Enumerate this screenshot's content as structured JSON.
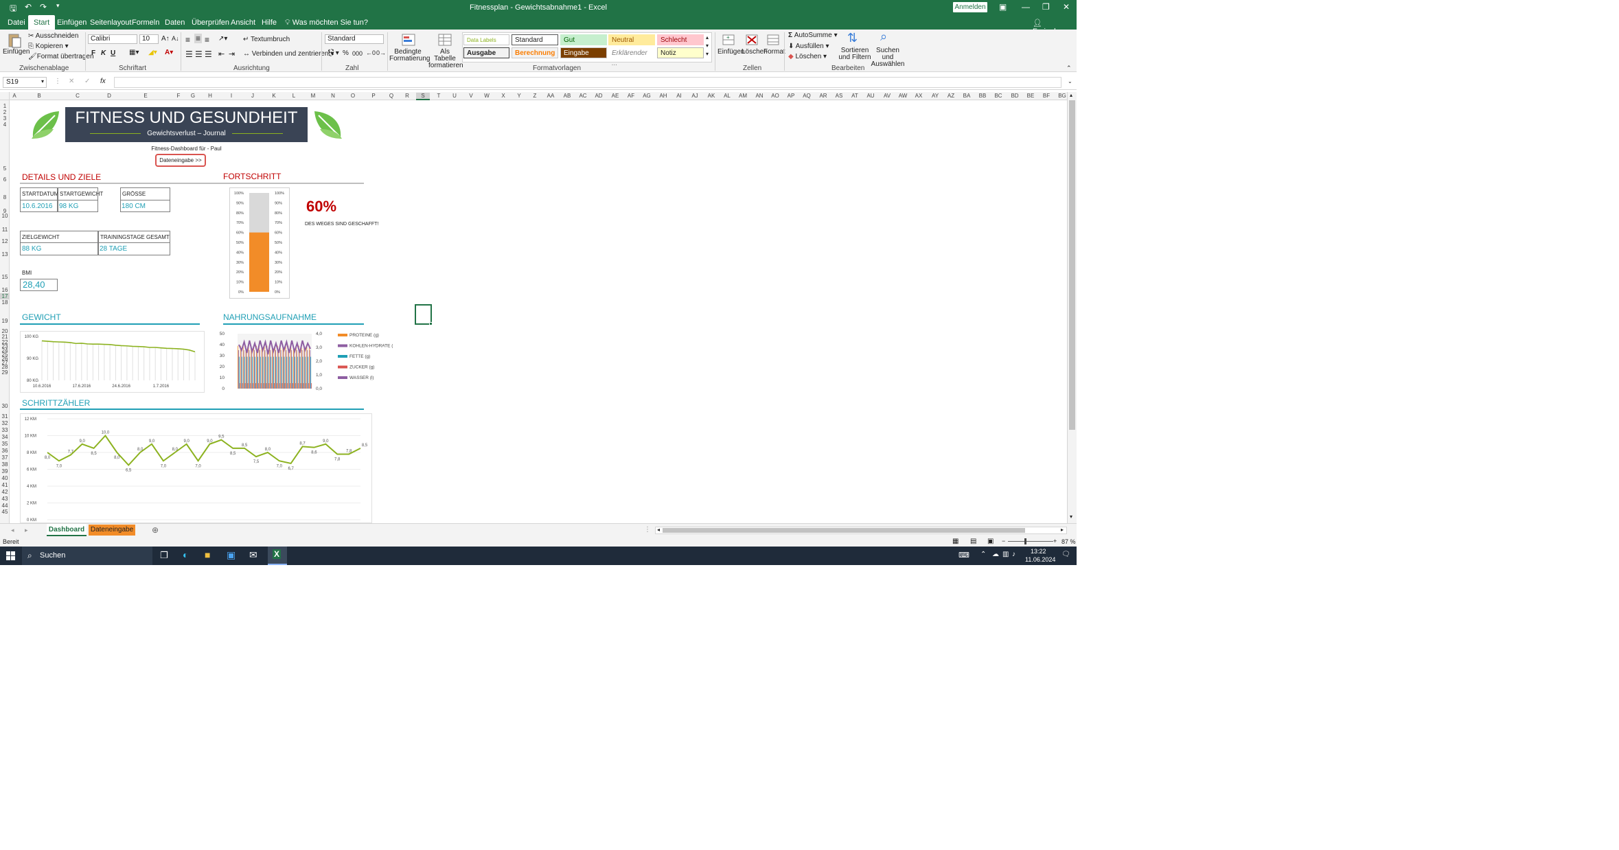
{
  "app": {
    "title": "Fitnessplan - Gewichtsabnahme1  -  Excel",
    "sign_in": "Anmelden",
    "share": "Freigeben",
    "tell_me": "Was möchten Sie tun?"
  },
  "tabs": [
    "Datei",
    "Start",
    "Einfügen",
    "Seitenlayout",
    "Formeln",
    "Daten",
    "Überprüfen",
    "Ansicht",
    "Hilfe"
  ],
  "ribbon": {
    "clipboard": {
      "paste": "Einfügen",
      "cut": "Ausschneiden",
      "copy": "Kopieren",
      "format_painter": "Format übertragen",
      "group": "Zwischenablage"
    },
    "font": {
      "name": "Calibri",
      "size": "10",
      "group": "Schriftart",
      "bold": "F",
      "italic": "K",
      "underline": "U"
    },
    "alignment": {
      "wrap": "Textumbruch",
      "merge": "Verbinden und zentrieren",
      "group": "Ausrichtung"
    },
    "number": {
      "format": "Standard",
      "group": "Zahl",
      "percent": "%",
      "thousands": "000"
    },
    "styles": {
      "cond": "Bedingte Formatierung",
      "table": "Als Tabelle formatieren",
      "group": "Formatvorlagen",
      "cells": [
        "Data Labels",
        "Standard",
        "Gut",
        "Neutral",
        "Schlecht",
        "Ausgabe",
        "Berechnung",
        "Eingabe",
        "Erklärender ...",
        "Notiz"
      ]
    },
    "cells": {
      "insert": "Einfügen",
      "delete": "Löschen",
      "format": "Format",
      "group": "Zellen"
    },
    "editing": {
      "autosum": "AutoSumme",
      "fill": "Ausfüllen",
      "clear": "Löschen",
      "sort": "Sortieren und Filtern",
      "find": "Suchen und Auswählen",
      "group": "Bearbeiten"
    }
  },
  "namebox": "S19",
  "columns": [
    "A",
    "B",
    "C",
    "D",
    "E",
    "F",
    "G",
    "H",
    "I",
    "J",
    "K",
    "L",
    "M",
    "N",
    "O",
    "P",
    "Q",
    "R",
    "S",
    "T",
    "U",
    "V",
    "W",
    "X",
    "Y",
    "Z",
    "AA",
    "AB",
    "AC",
    "AD",
    "AE",
    "AF",
    "AG",
    "AH",
    "AI",
    "AJ",
    "AK",
    "AL",
    "AM",
    "AN",
    "AO",
    "AP",
    "AQ",
    "AR",
    "AS",
    "AT",
    "AU",
    "AV",
    "AW",
    "AX",
    "AY",
    "AZ",
    "BA",
    "BB",
    "BC",
    "BD",
    "BE",
    "BF",
    "BG"
  ],
  "dashboard": {
    "title": "FITNESS UND GESUNDHEIT",
    "subtitle": "Gewichtsverlust – Journal",
    "for": "Fitness-Dashboard für - Paul",
    "data_entry_btn": "Dateneingabe >>",
    "details_heading": "DETAILS UND ZIELE",
    "progress_heading": "FORTSCHRITT",
    "start_date_label": "STARTDATUM",
    "start_date": "10.6.2016",
    "start_weight_label": "STARTGEWICHT",
    "start_weight": "98 KG",
    "height_label": "GRÖSSE",
    "height": "180 CM",
    "goal_weight_label": "ZIELGEWICHT",
    "goal_weight": "88 KG",
    "training_label": "TRAININGSTAGE GESAMT",
    "training": "28 TAGE",
    "bmi_label": "BMI",
    "bmi": "28,40",
    "progress_pct": "60%",
    "progress_text": "DES WEGES SIND GESCHAFFT!",
    "weight_heading": "GEWICHT",
    "nutrition_heading": "NAHRUNGSAUFNAHME",
    "steps_heading": "SCHRITTZÄHLER"
  },
  "chart_data": [
    {
      "type": "bar",
      "title": "",
      "progress": 0.6,
      "ylim": [
        0,
        100
      ],
      "ticks": [
        "100%",
        "90%",
        "80%",
        "70%",
        "60%",
        "50%",
        "40%",
        "30%",
        "20%",
        "10%",
        "0%"
      ],
      "color": "#f28c28"
    },
    {
      "type": "line",
      "title": "",
      "ytick_labels": [
        "100 KG",
        "90 KG",
        "80 KG"
      ],
      "ylim": [
        80,
        100
      ],
      "xtick_labels": [
        "10.6.2016",
        "17.6.2016",
        "24.6.2016",
        "1.7.2016"
      ],
      "values": [
        98,
        97.8,
        97.6,
        97.5,
        97.4,
        97.2,
        96.8,
        96.9,
        96.6,
        96.5,
        96.5,
        96.4,
        96.3,
        96.0,
        95.8,
        95.7,
        95.5,
        95.4,
        95.3,
        95.0,
        95.0,
        94.8,
        94.6,
        94.5,
        94.4,
        94.2,
        93.8,
        93.0
      ],
      "color": "#8cb21f"
    },
    {
      "type": "bar",
      "title": "",
      "y_left_ticks": [
        "50",
        "40",
        "30",
        "20",
        "10",
        "0"
      ],
      "y_right_ticks": [
        "4,0",
        "3,0",
        "2,0",
        "1,0",
        "0,0"
      ],
      "series": [
        {
          "name": "PROTEINE (g)",
          "color": "#f28c28"
        },
        {
          "name": "KOHLEN-HYDRATE (g)",
          "color": "#8e5ea2"
        },
        {
          "name": "FETTE (g)",
          "color": "#1f9fb5"
        },
        {
          "name": "ZUCKER (g)",
          "color": "#d9534f"
        },
        {
          "name": "WASSER (l)",
          "color": "#8e5ea2"
        }
      ]
    },
    {
      "type": "line",
      "title": "",
      "ytick_labels": [
        "12 KM",
        "10 KM",
        "8 KM",
        "6 KM",
        "4 KM",
        "2 KM",
        "0 KM"
      ],
      "ylim": [
        0,
        12
      ],
      "values": [
        8.0,
        7.0,
        7.7,
        9.0,
        8.5,
        10.0,
        8.0,
        6.5,
        8.0,
        9.0,
        7.0,
        8.0,
        9.0,
        7.0,
        9.0,
        9.5,
        8.5,
        8.5,
        7.5,
        8.0,
        7.0,
        6.7,
        8.7,
        8.6,
        9.0,
        7.8,
        7.8,
        8.5
      ],
      "labels": [
        "8,0",
        "7,0",
        "7,7",
        "9,0",
        "8,5",
        "10,0",
        "8,0",
        "6,5",
        "8,0",
        "9,0",
        "7,0",
        "8,0",
        "9,0",
        "7,0",
        "9,0",
        "9,5",
        "8,5",
        "8,5",
        "7,5",
        "8,0",
        "7,0",
        "6,7",
        "8,7",
        "8,6",
        "9,0",
        "7,8",
        "7,8",
        "8,5"
      ],
      "color": "#8cb21f"
    }
  ],
  "sheets": [
    "Dashboard",
    "Dateneingabe"
  ],
  "status": {
    "ready": "Bereit",
    "zoom": "87 %"
  },
  "taskbar": {
    "search": "Suchen",
    "time": "13:22",
    "date": "11.06.2024"
  },
  "colors": {
    "excel_green": "#217346",
    "accent_red": "#c00000",
    "accent_teal": "#1f9fb5",
    "orange": "#f28c28"
  }
}
